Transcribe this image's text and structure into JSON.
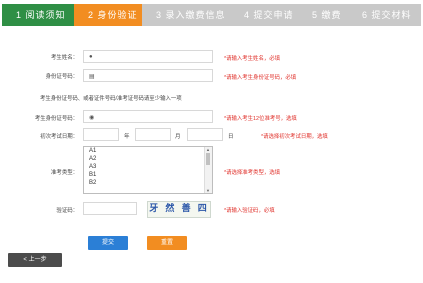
{
  "steps": [
    {
      "label": "1 阅读须知",
      "state": "done"
    },
    {
      "label": "2 身份验证",
      "state": "active"
    },
    {
      "label": "3 录入缴费信息",
      "state": "todo"
    },
    {
      "label": "4 提交申请",
      "state": "todo"
    },
    {
      "label": "5 缴费",
      "state": "todo"
    },
    {
      "label": "6 提交材料",
      "state": "todo"
    }
  ],
  "form": {
    "name": {
      "label": "考生姓名：",
      "value": "",
      "hint": "*请输入考生姓名，必填"
    },
    "id_number": {
      "label": "身份证号码：",
      "value": "",
      "hint": "*请输入考生身份证号码，必填"
    },
    "note": "考生身份证号码、或者证件号码/准考证号码请至少输入一项",
    "cert_number": {
      "label": "考生身份证号码：",
      "value": "",
      "hint": "*请输入考生12位准考号，选填"
    },
    "exam_date": {
      "label": "初次考试日期：",
      "year_unit": "年",
      "month_unit": "月",
      "day_unit": "日",
      "hint": "*请选择初次考试日期，选填"
    },
    "category": {
      "label": "准考类型：",
      "options": [
        "A1",
        "A2",
        "A3",
        "B1",
        "B2"
      ],
      "hint": "*请选择准考类型，选填"
    },
    "captcha": {
      "label": "验证码：",
      "value": "",
      "image_text": "牙 然 善 四",
      "hint": "*请输入验证码，必填"
    }
  },
  "buttons": {
    "submit": "提交",
    "reset": "重置",
    "prev": "< 上一步"
  },
  "colors": {
    "step_done": "#2f8f45",
    "step_active": "#f28d21",
    "step_todo": "#c9c9c9",
    "submit": "#2b7fd6",
    "reset": "#f28d21",
    "hint": "#e0302a"
  }
}
